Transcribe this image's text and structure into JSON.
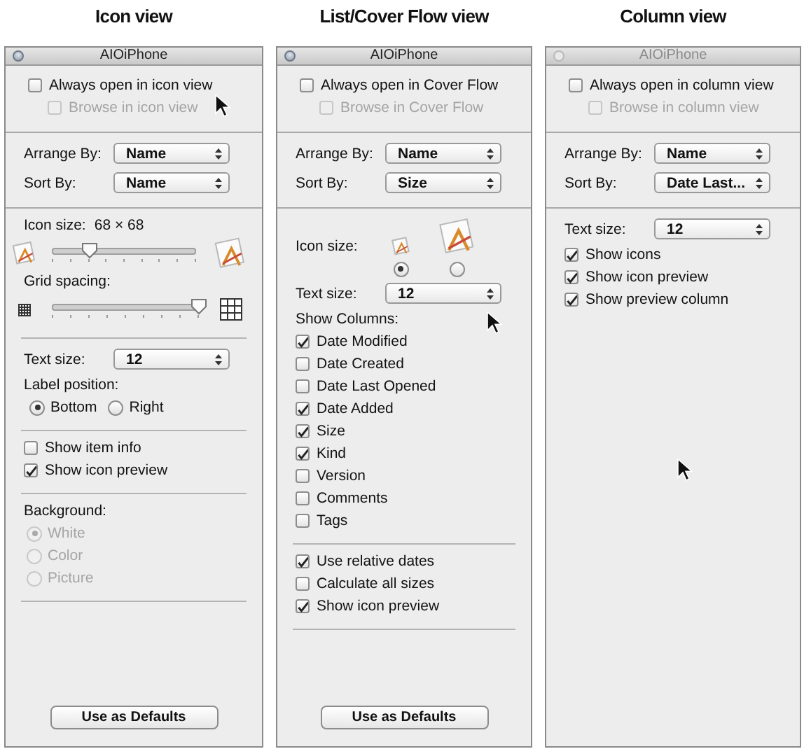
{
  "panels": [
    {
      "caption": "Icon view",
      "title": "AIOiPhone",
      "active": true,
      "open_options": [
        {
          "kind": "checkbox",
          "label": "Always open in icon view",
          "checked": false,
          "disabled": false
        },
        {
          "kind": "sub-checkbox",
          "label": "Browse in icon view",
          "checked": false,
          "disabled": true
        }
      ],
      "sort_options": [
        {
          "kind": "popup",
          "label": "Arrange By:",
          "value": "Name"
        },
        {
          "kind": "popup",
          "label": "Sort By:",
          "value": "Name"
        }
      ],
      "view_options": [
        [
          {
            "kind": "size-label",
            "label": "Icon size:",
            "value": "68 × 68"
          },
          {
            "kind": "icon-slider",
            "level": 0.26
          },
          {
            "kind": "heading",
            "text": "Grid spacing:"
          },
          {
            "kind": "grid-slider",
            "level": 1
          }
        ],
        [
          {
            "kind": "popup",
            "label": "Text size:",
            "value": "12"
          },
          {
            "kind": "heading",
            "text": "Label position:"
          },
          {
            "kind": "radio-row",
            "options": [
              {
                "label": "Bottom",
                "selected": true
              },
              {
                "label": "Right",
                "selected": false
              }
            ]
          }
        ],
        [
          {
            "kind": "checkbox",
            "label": "Show item info",
            "checked": false,
            "disabled": false
          },
          {
            "kind": "checkbox",
            "label": "Show icon preview",
            "checked": true,
            "disabled": false
          }
        ],
        [
          {
            "kind": "heading",
            "text": "Background:"
          },
          {
            "kind": "radio",
            "label": "White",
            "selected": true,
            "disabled": true
          },
          {
            "kind": "radio",
            "label": "Color",
            "selected": false,
            "disabled": true
          },
          {
            "kind": "radio",
            "label": "Picture",
            "selected": false,
            "disabled": true
          }
        ]
      ],
      "button": "Use as Defaults"
    },
    {
      "caption": "List/Cover Flow view",
      "title": "AIOiPhone",
      "active": true,
      "open_options": [
        {
          "kind": "checkbox",
          "label": "Always open in Cover Flow",
          "checked": false,
          "disabled": false
        },
        {
          "kind": "sub-checkbox",
          "label": "Browse in Cover Flow",
          "checked": false,
          "disabled": true
        }
      ],
      "sort_options": [
        {
          "kind": "popup",
          "label": "Arrange By:",
          "value": "Name"
        },
        {
          "kind": "popup",
          "label": "Sort By:",
          "value": "Size"
        }
      ],
      "view_options": [
        [
          {
            "kind": "icon-size-choice",
            "label": "Icon size:",
            "options": [
              {
                "selected": true
              },
              {
                "selected": false
              }
            ]
          },
          {
            "kind": "popup",
            "label": "Text size:",
            "value": "12"
          },
          {
            "kind": "heading",
            "text": "Show Columns:"
          },
          {
            "kind": "checkbox",
            "label": "Date Modified",
            "checked": true,
            "disabled": false
          },
          {
            "kind": "checkbox",
            "label": "Date Created",
            "checked": false,
            "disabled": false
          },
          {
            "kind": "checkbox",
            "label": "Date Last Opened",
            "checked": false,
            "disabled": false
          },
          {
            "kind": "checkbox",
            "label": "Date Added",
            "checked": true,
            "disabled": false
          },
          {
            "kind": "checkbox",
            "label": "Size",
            "checked": true,
            "disabled": false
          },
          {
            "kind": "checkbox",
            "label": "Kind",
            "checked": true,
            "disabled": false
          },
          {
            "kind": "checkbox",
            "label": "Version",
            "checked": false,
            "disabled": false
          },
          {
            "kind": "checkbox",
            "label": "Comments",
            "checked": false,
            "disabled": false
          },
          {
            "kind": "checkbox",
            "label": "Tags",
            "checked": false,
            "disabled": false
          }
        ],
        [
          {
            "kind": "checkbox",
            "label": "Use relative dates",
            "checked": true,
            "disabled": false
          },
          {
            "kind": "checkbox",
            "label": "Calculate all sizes",
            "checked": false,
            "disabled": false
          },
          {
            "kind": "checkbox",
            "label": "Show icon preview",
            "checked": true,
            "disabled": false
          }
        ]
      ],
      "button": "Use as Defaults"
    },
    {
      "caption": "Column view",
      "title": "AIOiPhone",
      "active": false,
      "open_options": [
        {
          "kind": "checkbox",
          "label": "Always open in column view",
          "checked": false,
          "disabled": false
        },
        {
          "kind": "sub-checkbox",
          "label": "Browse in column view",
          "checked": false,
          "disabled": true
        }
      ],
      "sort_options": [
        {
          "kind": "popup",
          "label": "Arrange By:",
          "value": "Name"
        },
        {
          "kind": "popup",
          "label": "Sort By:",
          "value": "Date Last..."
        }
      ],
      "view_options": [
        [
          {
            "kind": "popup",
            "label": "Text size:",
            "value": "12"
          },
          {
            "kind": "checkbox",
            "label": "Show icons",
            "checked": true,
            "disabled": false
          },
          {
            "kind": "checkbox",
            "label": "Show icon preview",
            "checked": true,
            "disabled": false
          },
          {
            "kind": "checkbox",
            "label": "Show preview column",
            "checked": true,
            "disabled": false
          }
        ]
      ]
    }
  ]
}
